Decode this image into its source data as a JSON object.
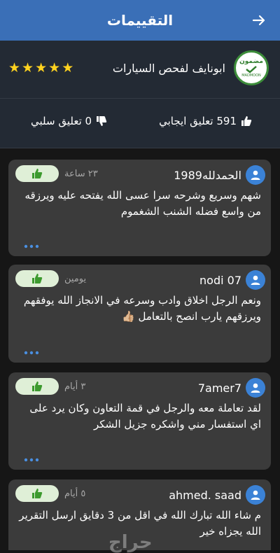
{
  "header": {
    "title": "التقييمات",
    "back_icon": "arrow-right-icon"
  },
  "provider": {
    "name": "ابونايف لفحص السيارات",
    "logo_text": "مضمون",
    "logo_sub": "MADMOON",
    "rating": 5
  },
  "stats": {
    "positive_text": "591 تعليق ايجابي",
    "negative_text": "0 تعليق سلبي"
  },
  "reviews": [
    {
      "name": "الحمدلله1989",
      "time": "٢٣ ساعة",
      "comment": "شهم وسريع وشرحه سرا عسى الله يفتحه عليه ويرزقه من واسع فضله الشنب الشغموم"
    },
    {
      "name": "nodi 07",
      "time": "يومين",
      "comment": "ونعم الرجل اخلاق وادب وسرعه في الانجاز الله يوفقهم ويرزقهم يارب   انصح بالتعامل 👍🏼"
    },
    {
      "name": "7amer7",
      "time": "٣ أيام",
      "comment": "لقد تعاملة معه والرجل في قمة التعاون وكان يرد على اي استفسار مني واشكره جزيل الشكر"
    },
    {
      "name": "ahmed. saad",
      "time": "٥ أيام",
      "comment": "م شاء الله تبارك الله في اقل من 3 دقايق ارسل التقرير الله يجزاه خير"
    }
  ],
  "watermark": "حراج",
  "colors": {
    "header": "#3a6fb7",
    "star": "#ffd21f",
    "like_bg": "#dfefd7",
    "like_icon": "#3c9a2e",
    "avatar": "#3b82d6"
  }
}
